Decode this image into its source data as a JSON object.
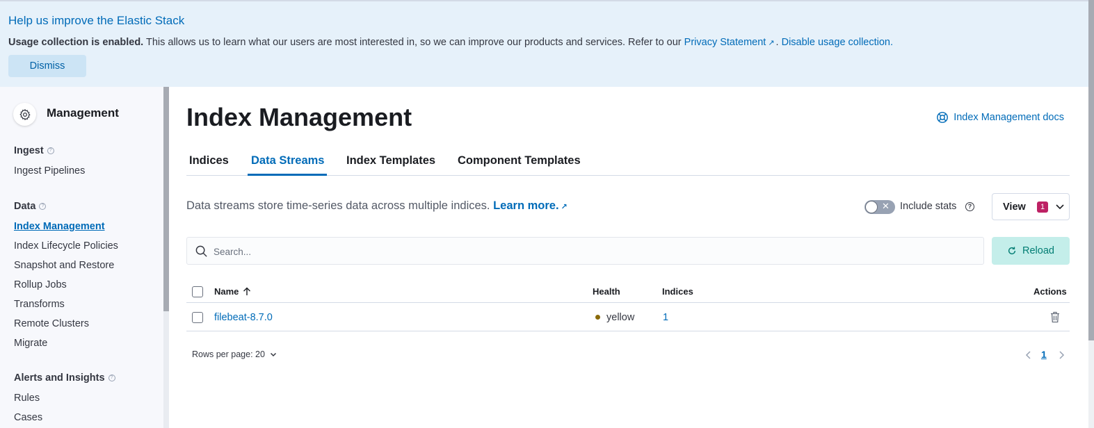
{
  "banner": {
    "title": "Help us improve the Elastic Stack",
    "bold_text": "Usage collection is enabled.",
    "body_text": " This allows us to learn what our users are most interested in, so we can improve our products and services. Refer to our ",
    "privacy_link": "Privacy Statement",
    "separator": ".",
    "disable_link": "Disable usage collection.",
    "dismiss_label": "Dismiss"
  },
  "sidebar": {
    "title": "Management",
    "groups": [
      {
        "label": "Ingest",
        "items": [
          "Ingest Pipelines"
        ]
      },
      {
        "label": "Data",
        "items": [
          "Index Management",
          "Index Lifecycle Policies",
          "Snapshot and Restore",
          "Rollup Jobs",
          "Transforms",
          "Remote Clusters",
          "Migrate"
        ]
      },
      {
        "label": "Alerts and Insights",
        "items": [
          "Rules",
          "Cases"
        ]
      }
    ],
    "active_item": "Index Management"
  },
  "page": {
    "title": "Index Management",
    "docs_link": "Index Management docs",
    "tabs": [
      "Indices",
      "Data Streams",
      "Index Templates",
      "Component Templates"
    ],
    "active_tab": "Data Streams",
    "description": "Data streams store time-series data across multiple indices.",
    "learn_more": "Learn more.",
    "include_stats_label": "Include stats",
    "view_label": "View",
    "view_badge": "1",
    "search_placeholder": "Search...",
    "reload_label": "Reload"
  },
  "table": {
    "columns": [
      "Name",
      "Health",
      "Indices",
      "Actions"
    ],
    "rows": [
      {
        "name": "filebeat-8.7.0",
        "health": "yellow",
        "indices": "1"
      }
    ],
    "rows_per_page": "Rows per page: 20",
    "current_page": "1"
  },
  "colors": {
    "accent": "#006bb8",
    "health_yellow": "#8a6a0a",
    "badge": "#bd2164",
    "reload_bg": "#c4eeea"
  }
}
